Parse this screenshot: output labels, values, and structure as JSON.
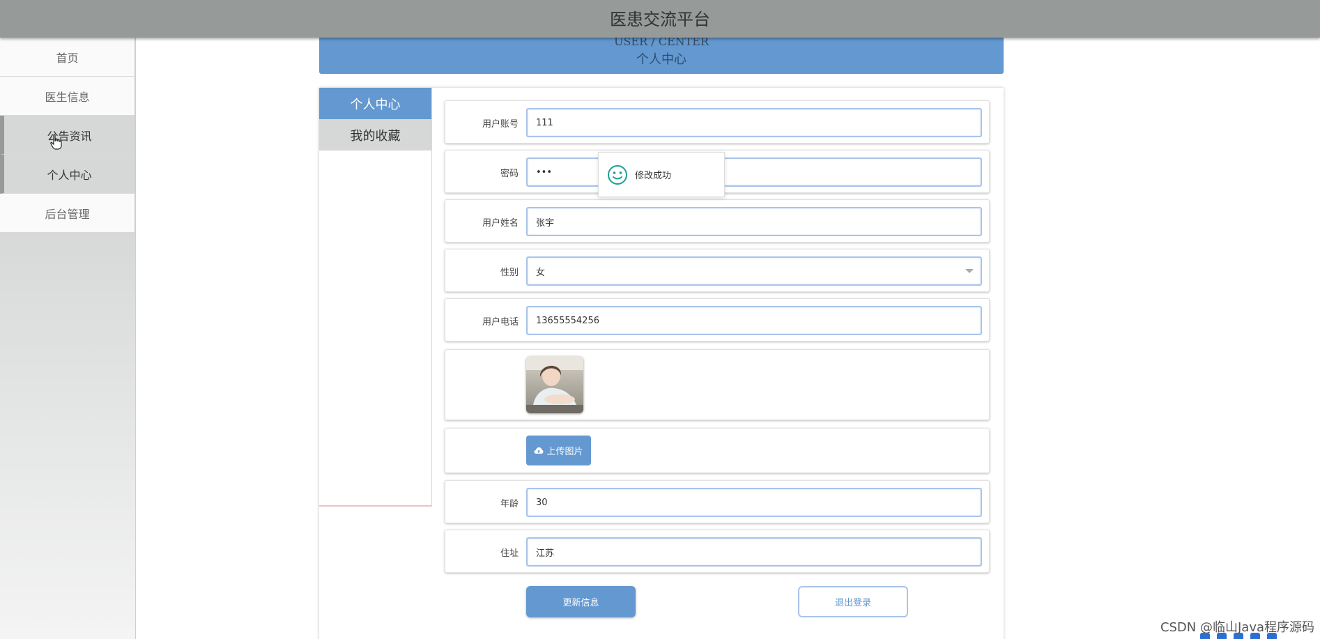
{
  "header": {
    "app_title": "医患交流平台"
  },
  "sidebar": {
    "items": [
      {
        "label": "首页",
        "active": false
      },
      {
        "label": "医生信息",
        "active": false
      },
      {
        "label": "公告资讯",
        "active": true
      },
      {
        "label": "个人中心",
        "active": true
      },
      {
        "label": "后台管理",
        "active": false
      }
    ]
  },
  "banner": {
    "en_title": "USER / CENTER",
    "cn_title": "个人中心"
  },
  "tabs": [
    {
      "label": "个人中心",
      "active": true
    },
    {
      "label": "我的收藏",
      "active": false
    }
  ],
  "form": {
    "account": {
      "label": "用户账号",
      "value": "111"
    },
    "password": {
      "label": "密码",
      "value": "•••"
    },
    "name": {
      "label": "用户姓名",
      "value": "张宇"
    },
    "gender": {
      "label": "性别",
      "value": "女"
    },
    "phone": {
      "label": "用户电话",
      "value": "13655554256"
    },
    "upload": {
      "label": "上传图片",
      "icon": "cloud-upload-icon"
    },
    "age": {
      "label": "年龄",
      "value": "30"
    },
    "address": {
      "label": "住址",
      "value": "江苏"
    }
  },
  "actions": {
    "update_label": "更新信息",
    "logout_label": "退出登录"
  },
  "toast": {
    "message": "修改成功",
    "icon": "smile-icon"
  },
  "watermark": {
    "text": "CSDN @临山Java程序源码"
  },
  "colors": {
    "primary": "#6498d0",
    "topbar": "#969a99",
    "toast_icon": "#1aa093"
  }
}
